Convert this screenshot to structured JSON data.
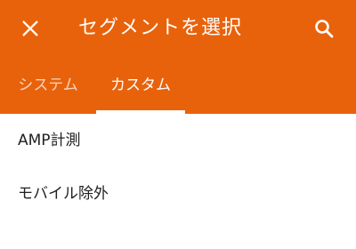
{
  "header": {
    "title": "セグメントを選択",
    "background_color": "#e8620c",
    "close_icon": "close-icon",
    "search_icon": "search-icon"
  },
  "tabs": [
    {
      "label": "システム",
      "selected": false
    },
    {
      "label": "カスタム",
      "selected": true
    }
  ],
  "segments": [
    {
      "label": "AMP計測"
    },
    {
      "label": "モバイル除外"
    }
  ]
}
